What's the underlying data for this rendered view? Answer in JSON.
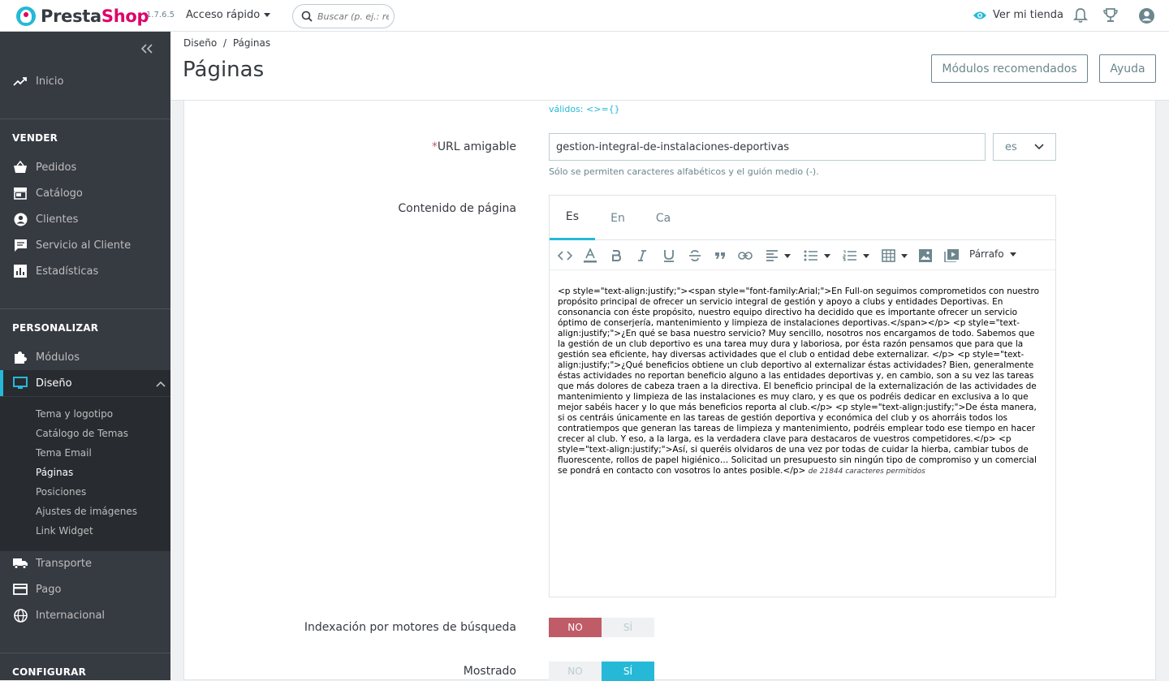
{
  "topbar": {
    "brand_main": "Presta",
    "brand_accent": "Shop",
    "version": "1.7.6.5",
    "quick_access": "Acceso rápido",
    "search_placeholder": "Buscar (p. ej.: re",
    "view_store": "Ver mi tienda"
  },
  "sidebar": {
    "home": "Inicio",
    "sell_title": "VENDER",
    "orders": "Pedidos",
    "catalog": "Catálogo",
    "customers": "Clientes",
    "customer_service": "Servicio al Cliente",
    "stats": "Estadísticas",
    "customize_title": "PERSONALIZAR",
    "modules": "Módulos",
    "design": "Diseño",
    "design_sub": {
      "theme_logo": "Tema y logotipo",
      "theme_catalog": "Catálogo de Temas",
      "email_theme": "Tema Email",
      "pages": "Páginas",
      "positions": "Posiciones",
      "image_settings": "Ajustes de imágenes",
      "link_widget": "Link Widget"
    },
    "shipping": "Transporte",
    "payment": "Pago",
    "international": "Internacional",
    "configure_title": "CONFIGURAR"
  },
  "header": {
    "breadcrumb_parent": "Diseño",
    "breadcrumb_sep": "/",
    "breadcrumb_current": "Páginas",
    "title": "Páginas",
    "recommended_modules": "Módulos recomendados",
    "help": "Ayuda"
  },
  "form": {
    "valid_chars_help": "válidos: <>={}",
    "url_required_mark": "*",
    "url_label": "URL amigable",
    "url_value": "gestion-integral-de-instalaciones-deportivas",
    "url_lang": "es",
    "url_help": "Sólo se permiten caracteres alfabéticos y el guión medio (-).",
    "content_label": "Contenido de página",
    "tabs": [
      "Es",
      "En",
      "Ca"
    ],
    "format_label": "Párrafo",
    "content_html": "<p style=\"text-align:justify;\"><span style=\"font-family:Arial;\">En Full-on seguimos comprometidos con nuestro propósito principal de ofrecer un servicio integral de gestión y apoyo a clubs y entidades Deportivas. En consonancia con éste propósito, nuestro equipo directivo ha decidido que es importante ofrecer un servicio óptimo de conserjería, mantenimiento y limpieza de instalaciones deportivas.</span></p> <p style=\"text-align:justify;\">¿En qué se basa nuestro servicio? Muy sencillo, nosotros nos encargamos de todo. Sabemos que la gestión de un club deportivo es una tarea muy dura y laboriosa, por ésta razón pensamos que para que la gestión sea eficiente, hay diversas actividades que el club o entidad debe externalizar. </p> <p style=\"text-align:justify;\">¿Qué beneficios obtiene un club deportivo al externalizar éstas actividades? Bien, generalmente éstas actividades no reportan beneficio alguno a las entidades deportivas y, en cambio, son a su vez las tareas que más dolores de cabeza traen a la directiva. El beneficio principal de la externalización de las actividades de mantenimiento y limpieza de las instalaciones es muy claro, y es que os podréis dedicar en exclusiva a lo que mejor sabéis hacer y lo que más beneficios reporta al club.</p> <p style=\"text-align:justify;\">De ésta manera, si os centráis únicamente en las tareas de gestión deportiva y económica del club y os ahorráis todos los contratiempos que generan las tareas de limpieza y mantenimiento, podréis emplear todo ese tiempo en hacer crecer al club. Y eso, a la larga, es la verdadera clave para destacaros de vuestros competidores.</p> <p style=\"text-align:justify;\">Así, si queréis olvidaros de una vez por todas de cuidar la hierba, cambiar tubos de fluorescente, rollos de papel higiénico… Solicitad un presupuesto sin ningún tipo de compromiso y un comercial se pondrá en contacto con vosotros lo antes posible.</p>",
    "char_count": "de 21844 caracteres permitidos",
    "indexing_label": "Indexación por motores de búsqueda",
    "indexing_no": "NO",
    "indexing_yes": "SÍ",
    "displayed_label": "Mostrado",
    "displayed_no": "NO",
    "displayed_yes": "SÍ"
  },
  "colors": {
    "accent": "#25b9d7",
    "brand": "#df0067",
    "sidebar_bg": "#363a41",
    "danger": "#c05c67"
  }
}
